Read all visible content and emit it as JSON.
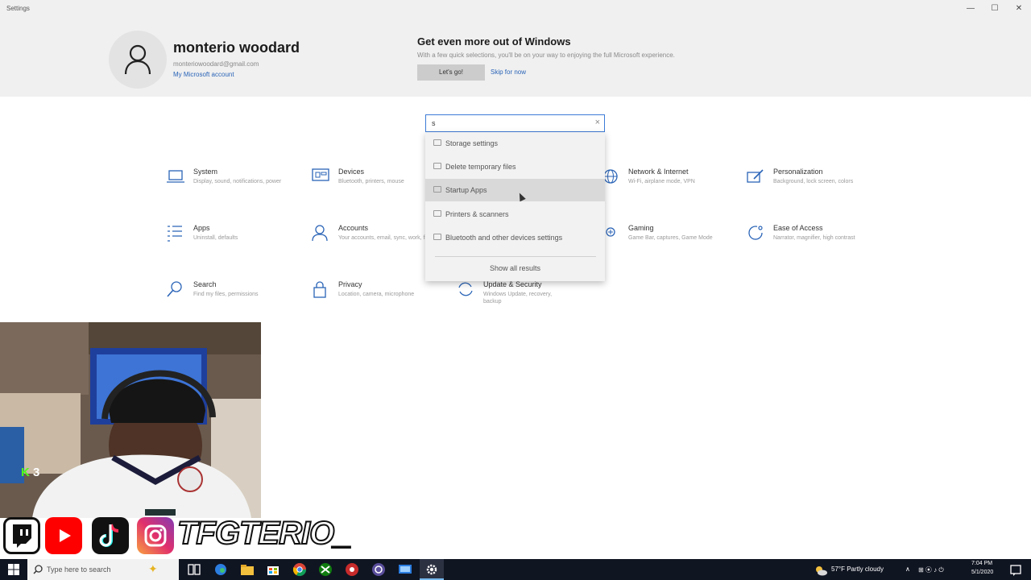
{
  "window": {
    "title": "Settings",
    "minimize": "—",
    "maximize": "☐",
    "close": "✕"
  },
  "account": {
    "name": "monterio woodard",
    "email": "monteriowoodard@gmail.com",
    "link": "My Microsoft account"
  },
  "promo": {
    "title": "Get even more out of Windows",
    "text": "With a few quick selections, you'll be on your way to enjoying the full Microsoft experience.",
    "primary_button": "Let's go!",
    "secondary_link": "Skip for now"
  },
  "search": {
    "value": "s",
    "clear": "×",
    "suggestions": [
      {
        "label": "Storage settings",
        "icon": "storage-icon"
      },
      {
        "label": "Delete temporary files",
        "icon": "storage-icon"
      },
      {
        "label": "Startup Apps",
        "icon": "startup-icon",
        "highlighted": true
      },
      {
        "label": "Printers & scanners",
        "icon": "printer-icon"
      },
      {
        "label": "Bluetooth and other devices settings",
        "icon": "bluetooth-icon"
      }
    ],
    "show_all": "Show all results"
  },
  "categories": [
    {
      "name": "System",
      "desc": "Display, sound, notifications, power",
      "icon": "laptop-icon"
    },
    {
      "name": "Devices",
      "desc": "Bluetooth, printers, mouse",
      "icon": "devices-icon"
    },
    {
      "name": "Network & Internet",
      "desc": "Wi-Fi, airplane mode, VPN",
      "icon": "globe-icon"
    },
    {
      "name": "Personalization",
      "desc": "Background, lock screen, colors",
      "icon": "brush-icon"
    },
    {
      "name": "Apps",
      "desc": "Uninstall, defaults",
      "icon": "apps-list-icon"
    },
    {
      "name": "Accounts",
      "desc": "Your accounts, email, sync, work, family",
      "icon": "person-icon"
    },
    {
      "name": "Gaming",
      "desc": "Game Bar, captures, Game Mode",
      "icon": "gamepad-icon"
    },
    {
      "name": "Ease of Access",
      "desc": "Narrator, magnifier, high contrast",
      "icon": "ease-icon"
    },
    {
      "name": "Search",
      "desc": "Find my files, permissions",
      "icon": "search-icon"
    },
    {
      "name": "Privacy",
      "desc": "Location, camera, microphone",
      "icon": "lock-icon"
    },
    {
      "name": "Update & Security",
      "desc": "Windows Update, recovery, backup",
      "icon": "update-icon"
    }
  ],
  "stream": {
    "handle": "TFGTERIO_",
    "badge": "3",
    "socials": [
      "twitch-icon",
      "youtube-icon",
      "tiktok-icon",
      "instagram-icon"
    ]
  },
  "taskbar": {
    "search_placeholder": "Type here to search",
    "weather": "57°F  Partly cloudy",
    "time": "7:04 PM",
    "date": "5/1/2020",
    "colors": {
      "bar": "#101522",
      "accent": "#76b9ed"
    }
  }
}
